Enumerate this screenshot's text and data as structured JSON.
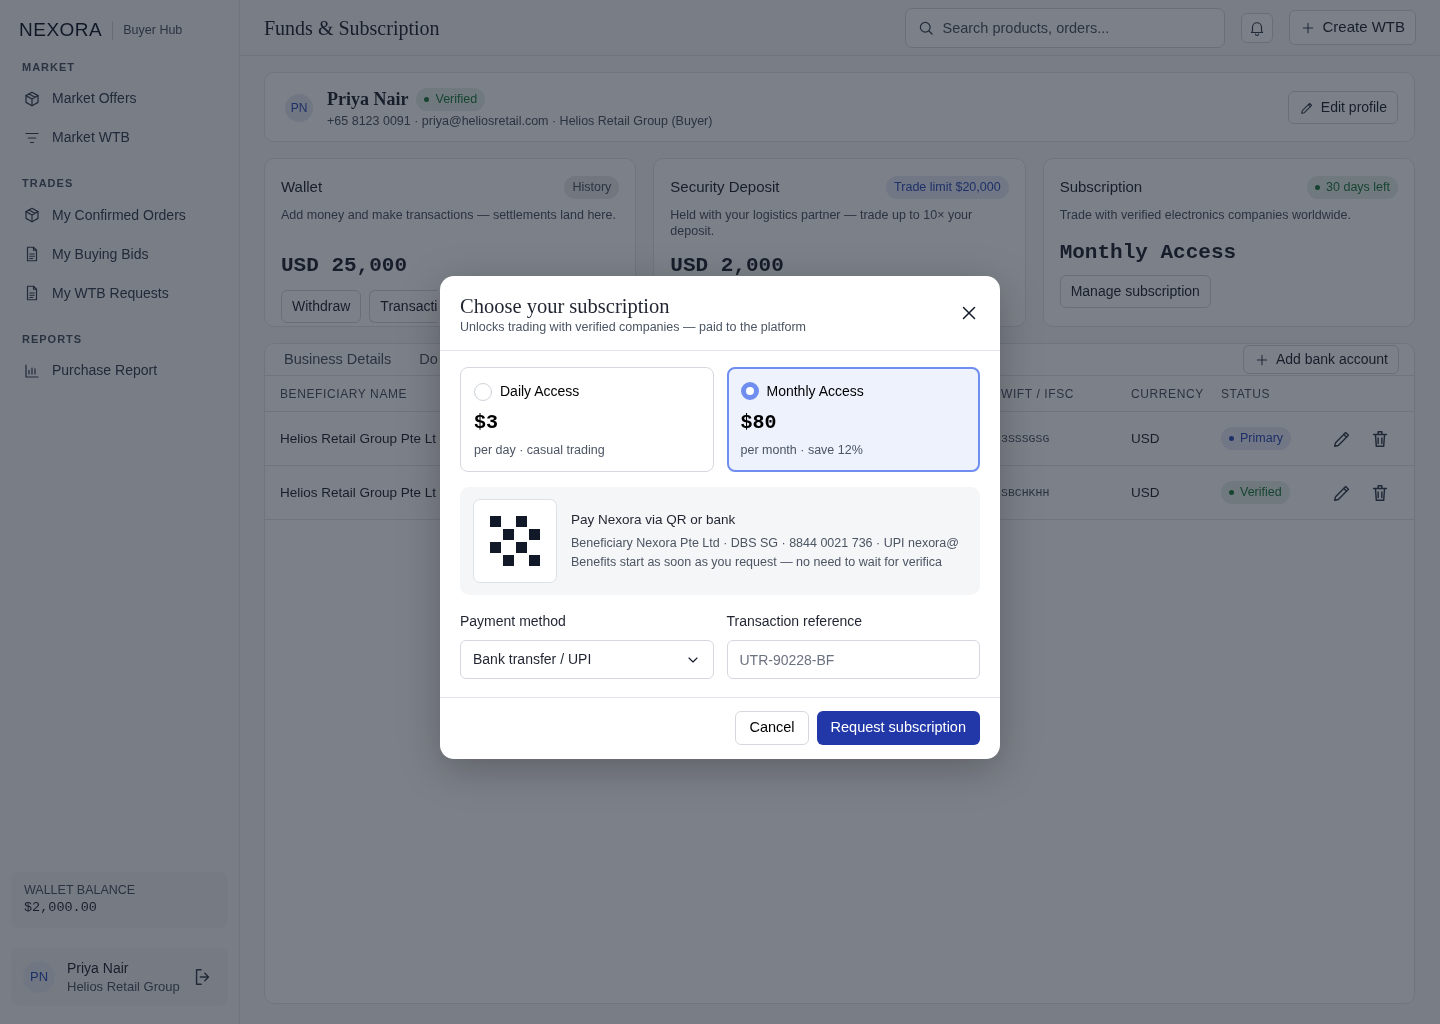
{
  "sidebar": {
    "brand": "NEXORA",
    "subtitle": "Buyer Hub",
    "sections": [
      {
        "heading": "MARKET",
        "items": [
          {
            "label": "Market Offers",
            "selected": false
          },
          {
            "label": "Market WTB",
            "selected": false
          }
        ]
      },
      {
        "heading": "TRADES",
        "items": [
          {
            "label": "My Confirmed Orders",
            "selected": false
          },
          {
            "label": "My Buying Bids",
            "selected": false
          },
          {
            "label": "My WTB Requests",
            "selected": false
          }
        ]
      },
      {
        "heading": "REPORTS",
        "items": [
          {
            "label": "Purchase Report",
            "selected": false
          }
        ]
      }
    ],
    "wallet": {
      "label": "WALLET BALANCE",
      "amount": "$2,000.00"
    },
    "user": {
      "initials": "PN",
      "name": "Priya Nair",
      "org": "Helios Retail Group"
    }
  },
  "header": {
    "title": "Funds & Subscription",
    "search_placeholder": "Search products, orders...",
    "create_button": "Create WTB"
  },
  "profile": {
    "initials": "PN",
    "name": "Priya Nair",
    "badge": {
      "label": "Verified",
      "kind": "success"
    },
    "details": "+65 8123 0091 · priya@heliosretail.com · Helios Retail Group (Buyer)",
    "edit_button": "Edit profile"
  },
  "cards": [
    {
      "title": "Wallet",
      "badge": {
        "label": "History",
        "kind": "neutral"
      },
      "description": "Add money and make transactions — settlements land here.",
      "amount": "USD 25,000",
      "buttons": [
        "Withdraw",
        "Transacti"
      ]
    },
    {
      "title": "Security Deposit",
      "badge": {
        "label": "Trade limit $20,000",
        "kind": "info"
      },
      "description": "Held with your logistics partner — trade up to 10× your deposit.",
      "amount": "USD 2,000"
    },
    {
      "title": "Subscription",
      "badge": {
        "label": "30 days left",
        "kind": "success"
      },
      "description": "Trade with verified electronics companies worldwide.",
      "amount": "Monthly Access",
      "buttons": [
        "Manage subscription"
      ]
    }
  ],
  "accounts": {
    "tabs": [
      {
        "label": "Business Details",
        "selected": false
      },
      {
        "label": "Do",
        "selected": false
      }
    ],
    "add_button": "Add bank account",
    "columns": [
      "BENEFICIARY NAME",
      "WIFT / IFSC",
      "CURRENCY",
      "STATUS"
    ],
    "rows": [
      {
        "name": "Helios Retail Group Pte Lt",
        "swift": "3SSSGSG",
        "currency": "USD",
        "status": {
          "label": "Primary",
          "kind": "primary"
        }
      },
      {
        "name": "Helios Retail Group Pte Lt",
        "swift": "SBCHKHH",
        "currency": "USD",
        "status": {
          "label": "Verified",
          "kind": "success"
        }
      }
    ]
  },
  "modal": {
    "title": "Choose your subscription",
    "subtitle": "Unlocks trading with verified companies — paid to the platform",
    "plans": [
      {
        "name": "Daily Access",
        "price": "$3",
        "note": "per day · casual trading",
        "selected": false
      },
      {
        "name": "Monthly Access",
        "price": "$80",
        "note": "per month · save 12%",
        "selected": true
      }
    ],
    "payment": {
      "title": "Pay Nexora via QR or bank",
      "lines": [
        "Beneficiary Nexora Pte Ltd · DBS SG · 8844 0021 736 · UPI nexora@",
        "Benefits start as soon as you request — no need to wait for verifica"
      ]
    },
    "method": {
      "label": "Payment method",
      "value": "Bank transfer / UPI"
    },
    "reference": {
      "label": "Transaction reference",
      "placeholder": "UTR-90228-BF"
    },
    "cancel": "Cancel",
    "submit": "Request subscription"
  }
}
